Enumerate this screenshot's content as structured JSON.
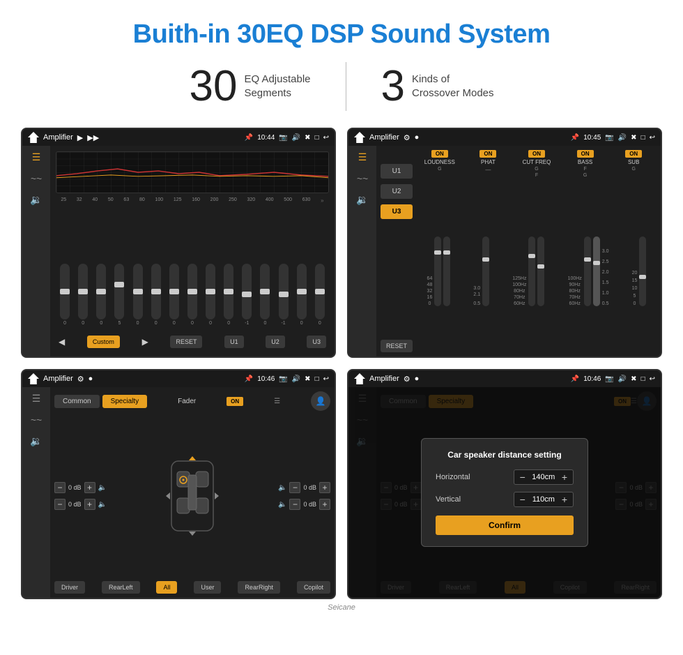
{
  "page": {
    "title": "Buith-in 30EQ DSP Sound System",
    "watermark": "Seicane"
  },
  "stats": {
    "eq_number": "30",
    "eq_label": "EQ Adjustable\nSegments",
    "crossover_number": "3",
    "crossover_label": "Kinds of\nCrossover Modes"
  },
  "screen_tl": {
    "title": "Amplifier",
    "time": "10:44",
    "frequencies": [
      "25",
      "32",
      "40",
      "50",
      "63",
      "80",
      "100",
      "125",
      "160",
      "200",
      "250",
      "320",
      "400",
      "500",
      "630"
    ],
    "values": [
      "0",
      "0",
      "0",
      "5",
      "0",
      "0",
      "0",
      "0",
      "0",
      "0",
      "-1",
      "0",
      "-1",
      "0",
      "0"
    ],
    "presets": [
      "Custom",
      "RESET",
      "U1",
      "U2",
      "U3"
    ]
  },
  "screen_tr": {
    "title": "Amplifier",
    "time": "10:45",
    "channels": [
      "LOUDNESS",
      "PHAT",
      "CUT FREQ",
      "BASS",
      "SUB"
    ],
    "preset_u3_active": true,
    "presets": [
      "U1",
      "U2",
      "U3"
    ],
    "reset_label": "RESET"
  },
  "screen_bl": {
    "title": "Amplifier",
    "time": "10:46",
    "modes": [
      "Common",
      "Specialty"
    ],
    "fader_label": "Fader",
    "db_values": [
      "0 dB",
      "0 dB",
      "0 dB",
      "0 dB"
    ],
    "position_btns": [
      "Driver",
      "RearLeft",
      "All",
      "User",
      "RearRight",
      "Copilot"
    ]
  },
  "screen_br": {
    "title": "Amplifier",
    "time": "10:46",
    "dialog": {
      "title": "Car speaker distance setting",
      "horizontal_label": "Horizontal",
      "horizontal_value": "140cm",
      "vertical_label": "Vertical",
      "vertical_value": "110cm",
      "confirm_label": "Confirm"
    },
    "db_values": [
      "0 dB",
      "0 dB"
    ],
    "position_btns": [
      "Driver",
      "RearLeft",
      "All",
      "Copilot",
      "RearRight"
    ]
  }
}
